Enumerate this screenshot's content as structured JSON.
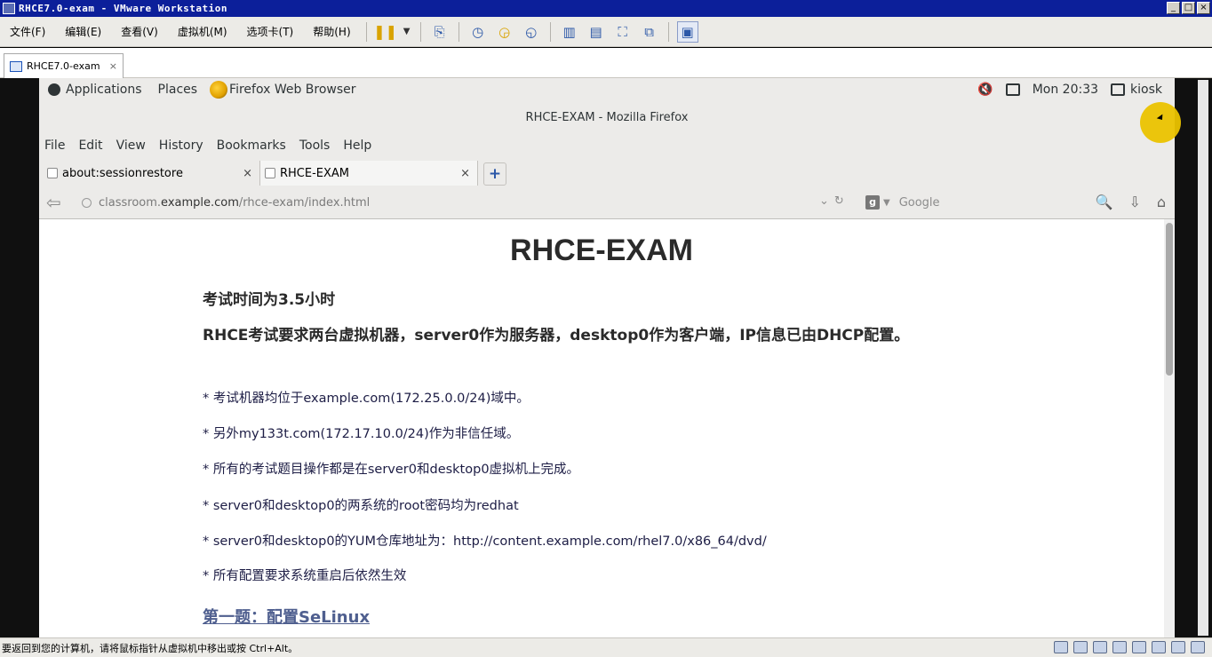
{
  "vmware": {
    "window_title": "RHCE7.0-exam - VMware Workstation",
    "menu": [
      "文件(F)",
      "编辑(E)",
      "查看(V)",
      "虚拟机(M)",
      "选项卡(T)",
      "帮助(H)"
    ],
    "tab": {
      "label": "RHCE7.0-exam",
      "close": "×"
    },
    "status_text": "要返回到您的计算机，请将鼠标指针从虚拟机中移出或按 Ctrl+Alt。",
    "win_min": "_",
    "win_max": "□",
    "win_close": "×"
  },
  "gnome": {
    "applications": "Applications",
    "places": "Places",
    "active_app": "Firefox Web Browser",
    "clock": "Mon 20:33",
    "user": "kiosk"
  },
  "firefox": {
    "window_title": "RHCE-EXAM - Mozilla Firefox",
    "menu": [
      "File",
      "Edit",
      "View",
      "History",
      "Bookmarks",
      "Tools",
      "Help"
    ],
    "tabs": [
      {
        "label": "about:sessionrestore",
        "close": "×"
      },
      {
        "label": "RHCE-EXAM",
        "close": "×"
      }
    ],
    "new_tab": "+",
    "url": {
      "prefix": "classroom.",
      "domain": "example.com",
      "path": "/rhce-exam/index.html"
    },
    "search_placeholder": "Google",
    "search_engine": "g"
  },
  "page": {
    "title": "RHCE-EXAM",
    "h1": "考试时间为3.5小时",
    "h2": "RHCE考试要求两台虚拟机器，server0作为服务器，desktop0作为客户端，IP信息已由DHCP配置。",
    "items": [
      "* 考试机器均位于example.com(172.25.0.0/24)域中。",
      "* 另外my133t.com(172.17.10.0/24)作为非信任域。",
      "* 所有的考试题目操作都是在server0和desktop0虚拟机上完成。",
      "* server0和desktop0的两系统的root密码均为redhat",
      "* server0和desktop0的YUM仓库地址为：http://content.example.com/rhel7.0/x86_64/dvd/",
      "* 所有配置要求系统重启后依然生效"
    ],
    "section_link": "第一题：配置SeLinux"
  },
  "colors": {
    "vm_title_bg": "#0c1f9a",
    "cursor_highlight": "#ebc300",
    "link": "#4f5f8f"
  }
}
